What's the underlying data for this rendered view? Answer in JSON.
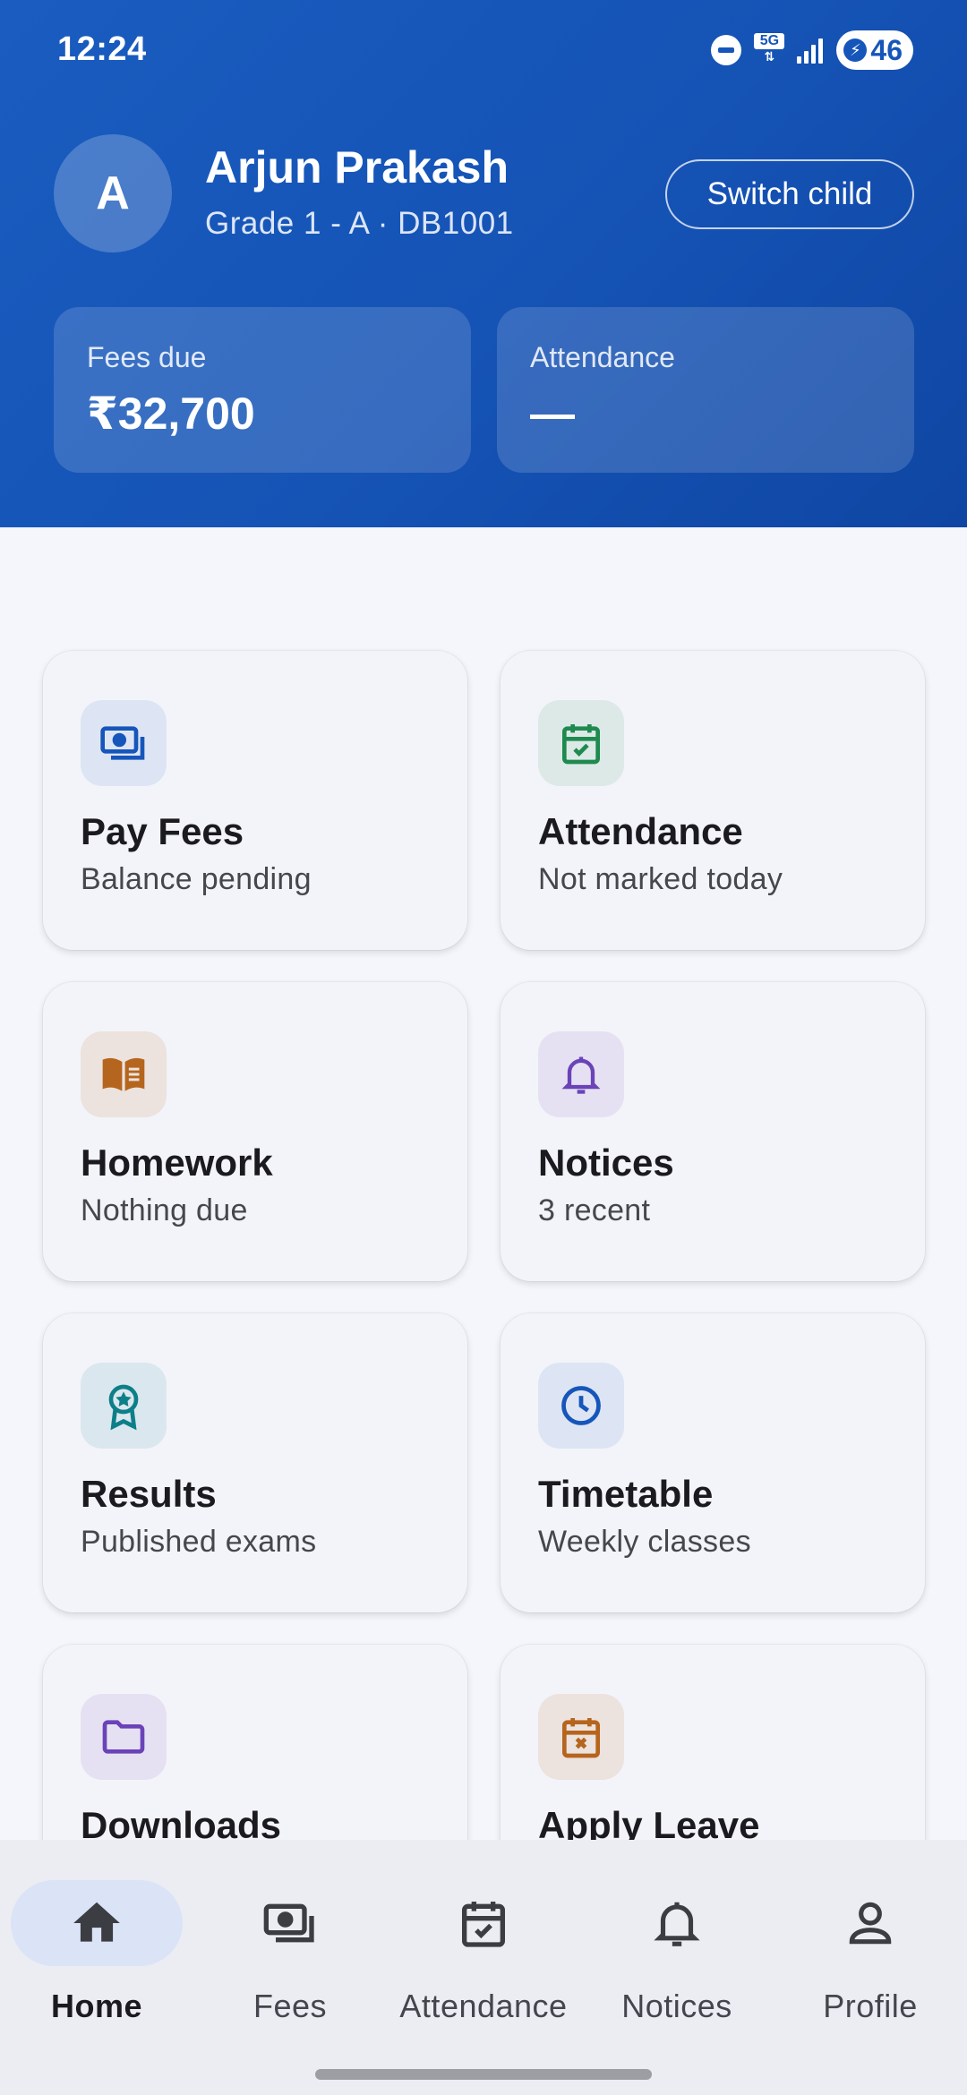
{
  "status_bar": {
    "time": "12:24",
    "network": "5G",
    "battery": "46"
  },
  "child": {
    "initial": "A",
    "name": "Arjun Prakash",
    "meta": "Grade 1 - A · DB1001",
    "switch_label": "Switch child"
  },
  "summary": {
    "fees": {
      "label": "Fees due",
      "value": "₹32,700"
    },
    "attendance": {
      "label": "Attendance",
      "value": "—"
    }
  },
  "tiles": [
    {
      "title": "Pay Fees",
      "subtitle": "Balance pending",
      "icon": "fees-icon",
      "color": "#1656ba",
      "bg": "#dde5f4"
    },
    {
      "title": "Attendance",
      "subtitle": "Not marked today",
      "icon": "calendar-check-icon",
      "color": "#1e8a4f",
      "bg": "#dde9e6"
    },
    {
      "title": "Homework",
      "subtitle": "Nothing due",
      "icon": "book-icon",
      "color": "#b5651d",
      "bg": "#ece2de"
    },
    {
      "title": "Notices",
      "subtitle": "3 recent",
      "icon": "bell-icon",
      "color": "#6a43b8",
      "bg": "#e6e1f2"
    },
    {
      "title": "Results",
      "subtitle": "Published exams",
      "icon": "award-icon",
      "color": "#0d7f89",
      "bg": "#dbe7ee"
    },
    {
      "title": "Timetable",
      "subtitle": "Weekly classes",
      "icon": "clock-icon",
      "color": "#1656ba",
      "bg": "#dde5f4"
    },
    {
      "title": "Downloads",
      "subtitle": "",
      "icon": "folder-icon",
      "color": "#6a43b8",
      "bg": "#e6e1f2"
    },
    {
      "title": "Apply Leave",
      "subtitle": "",
      "icon": "calendar-x-icon",
      "color": "#b5651d",
      "bg": "#ece2de"
    }
  ],
  "bottom_nav": [
    {
      "label": "Home",
      "icon": "home-icon",
      "active": true
    },
    {
      "label": "Fees",
      "icon": "fees-icon",
      "active": false
    },
    {
      "label": "Attendance",
      "icon": "calendar-check-icon",
      "active": false
    },
    {
      "label": "Notices",
      "icon": "bell-icon",
      "active": false
    },
    {
      "label": "Profile",
      "icon": "person-icon",
      "active": false
    }
  ],
  "colors": {
    "primary": "#1656ba",
    "background": "#f4f6fb",
    "nav_background": "#ecedf3"
  }
}
